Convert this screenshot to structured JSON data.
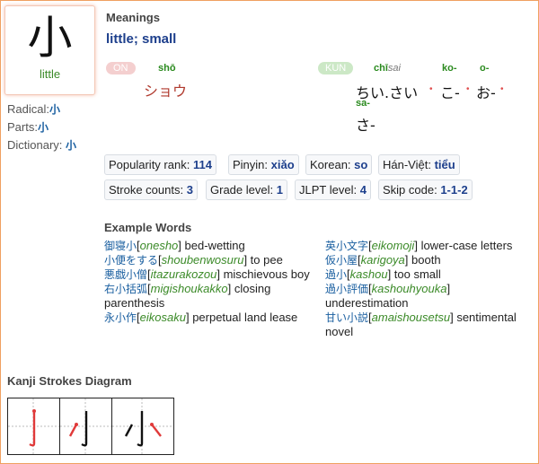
{
  "kanji": {
    "character": "小",
    "meaning": "little"
  },
  "side": {
    "radical_label": "Radical:",
    "radical_value": "小",
    "parts_label": "Parts:",
    "parts_value": "小",
    "dictionary_label": "Dictionary:",
    "dictionary_value": "小"
  },
  "meanings": {
    "title": "Meanings",
    "text": "little; small"
  },
  "on": {
    "badge": "ON",
    "romaji": "shō",
    "kana": "ショウ"
  },
  "kun": {
    "badge": "KUN",
    "items": [
      {
        "romaji_main": "chī",
        "romaji_okurigana": "sai",
        "kana": "ちい.さい"
      },
      {
        "romaji_main": "ko-",
        "romaji_okurigana": "",
        "kana": "こ-"
      },
      {
        "romaji_main": "o-",
        "romaji_okurigana": "",
        "kana": "お-"
      },
      {
        "romaji_main": "sa-",
        "romaji_okurigana": "",
        "kana": "さ-"
      }
    ]
  },
  "stats": [
    {
      "label": "Popularity rank:",
      "value": "114"
    },
    {
      "label": "Pinyin:",
      "value": "xiǎo"
    },
    {
      "label": "Korean:",
      "value": "so"
    },
    {
      "label": "Hán-Việt:",
      "value": "tiểu"
    },
    {
      "label": "Stroke counts:",
      "value": "3"
    },
    {
      "label": "Grade level:",
      "value": "1"
    },
    {
      "label": "JLPT level:",
      "value": "4"
    },
    {
      "label": "Skip code:",
      "value": "1-1-2"
    }
  ],
  "examples": {
    "title": "Example Words",
    "left": [
      {
        "word": "御寝小",
        "reading": "onesho",
        "meaning": "bed-wetting"
      },
      {
        "word": "小便をする",
        "reading": "shoubenwosuru",
        "meaning": "to pee"
      },
      {
        "word": "悪戯小僧",
        "reading": "itazurakozou",
        "meaning": "mischievous boy"
      },
      {
        "word": "右小括弧",
        "reading": "migishoukakko",
        "meaning": "closing parenthesis"
      },
      {
        "word": "永小作",
        "reading": "eikosaku",
        "meaning": "perpetual land lease"
      }
    ],
    "right": [
      {
        "word": "英小文字",
        "reading": "eikomoji",
        "meaning": "lower-case letters"
      },
      {
        "word": "仮小屋",
        "reading": "karigoya",
        "meaning": "booth"
      },
      {
        "word": "過小",
        "reading": "kashou",
        "meaning": "too small"
      },
      {
        "word": "過小評価",
        "reading": "kashouhyouka",
        "meaning": "underestimation"
      },
      {
        "word": "甘い小説",
        "reading": "amaishousetsu",
        "meaning": "sentimental novel"
      }
    ]
  },
  "strokes_diagram": {
    "title": "Kanji Strokes Diagram"
  }
}
